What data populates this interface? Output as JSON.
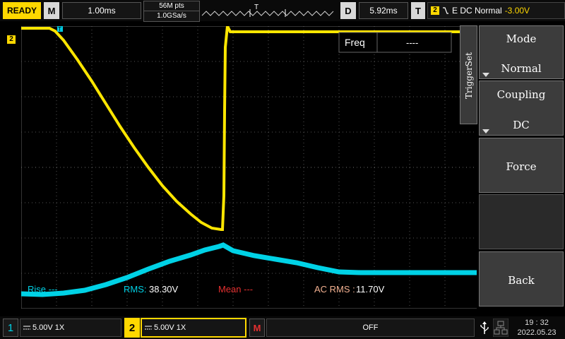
{
  "topbar": {
    "status": "READY",
    "mode_key": "M",
    "timebase": "1.00ms",
    "memory_depth": "56M pts",
    "sample_rate": "1.0GSa/s",
    "delay_key": "D",
    "delay": "5.92ms",
    "trigger_key": "T",
    "trigger_channel": "2",
    "trigger_summary": "E DC Normal",
    "trigger_level": "-3.00V"
  },
  "screen": {
    "ch2_marker": "2",
    "trigger_marker": "T",
    "trigger_top_marker": "T",
    "freq_label": "Freq",
    "freq_value": "----"
  },
  "measurements": {
    "rise": "Rise ---",
    "rms_label": "RMS:",
    "rms_value": "38.30V",
    "mean": "Mean ---",
    "acrms_label": "AC RMS :",
    "acrms_value": "11.70V"
  },
  "menu": {
    "tab": "TriggerSet",
    "mode_label": "Mode",
    "mode_value": "Normal",
    "coupling_label": "Coupling",
    "coupling_value": "DC",
    "force_label": "Force",
    "back_label": "Back"
  },
  "bottombar": {
    "ch1_num": "1",
    "ch1_scale": "5.00V 1X",
    "ch2_num": "2",
    "ch2_scale": "5.00V 1X",
    "math_key": "M",
    "math_state": "OFF",
    "time": "19 : 32",
    "date": "2022.05.23"
  },
  "colors": {
    "ch1": "#00d2e6",
    "ch2": "#ffe600",
    "status_bg": "#ffd800",
    "math": "#e53030",
    "mean_text": "#e53030",
    "acrms_text": "#f2b090"
  }
}
